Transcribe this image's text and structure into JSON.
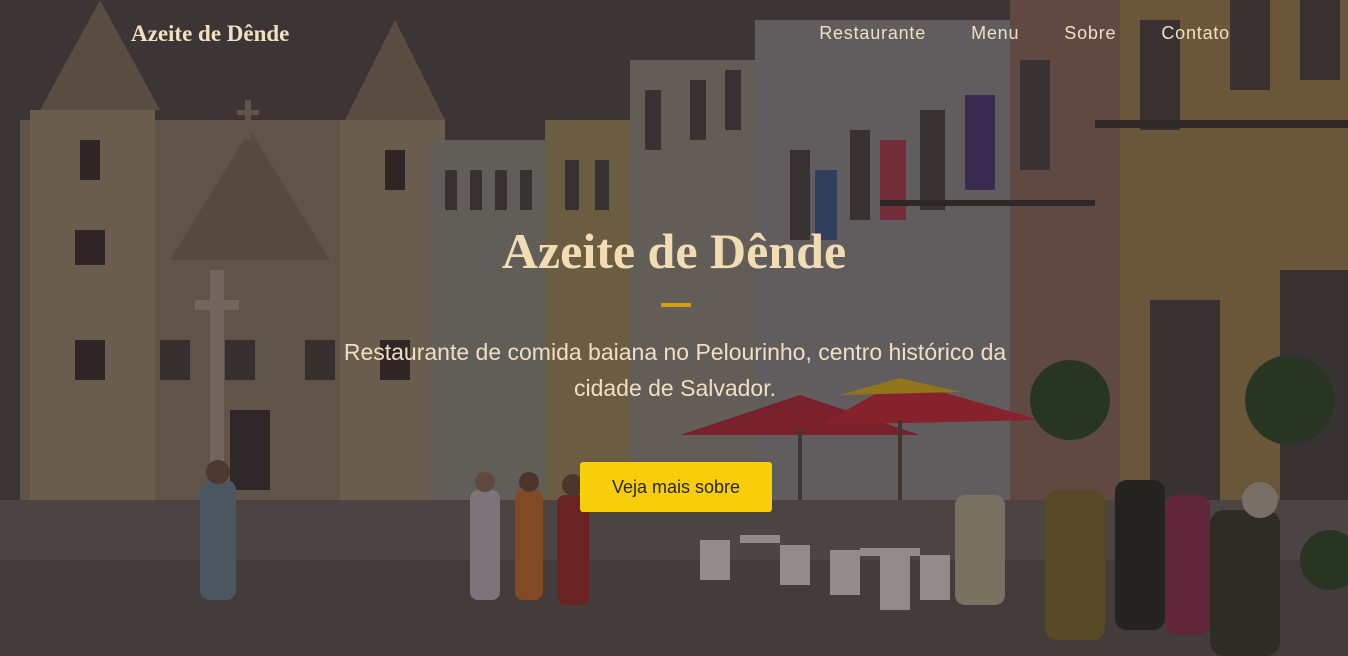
{
  "nav": {
    "brand": "Azeite de Dênde",
    "links": [
      "Restaurante",
      "Menu",
      "Sobre",
      "Contato"
    ]
  },
  "hero": {
    "title": "Azeite de Dênde",
    "subtitle": "Restaurante de comida baiana no Pelourinho, centro histórico da cidade de Salvador.",
    "cta_label": "Veja mais sobre"
  },
  "background": {
    "image_description": "Pelourinho square with baroque church towers, colorful colonial buildings, red umbrellas and pedestrians",
    "icons": {
      "umbrella": "umbrella-icon"
    }
  },
  "colors": {
    "accent": "#f8cd0a",
    "divider": "#d3a10c",
    "text_light": "#f0dfc2",
    "overlay": "#1e1616"
  }
}
